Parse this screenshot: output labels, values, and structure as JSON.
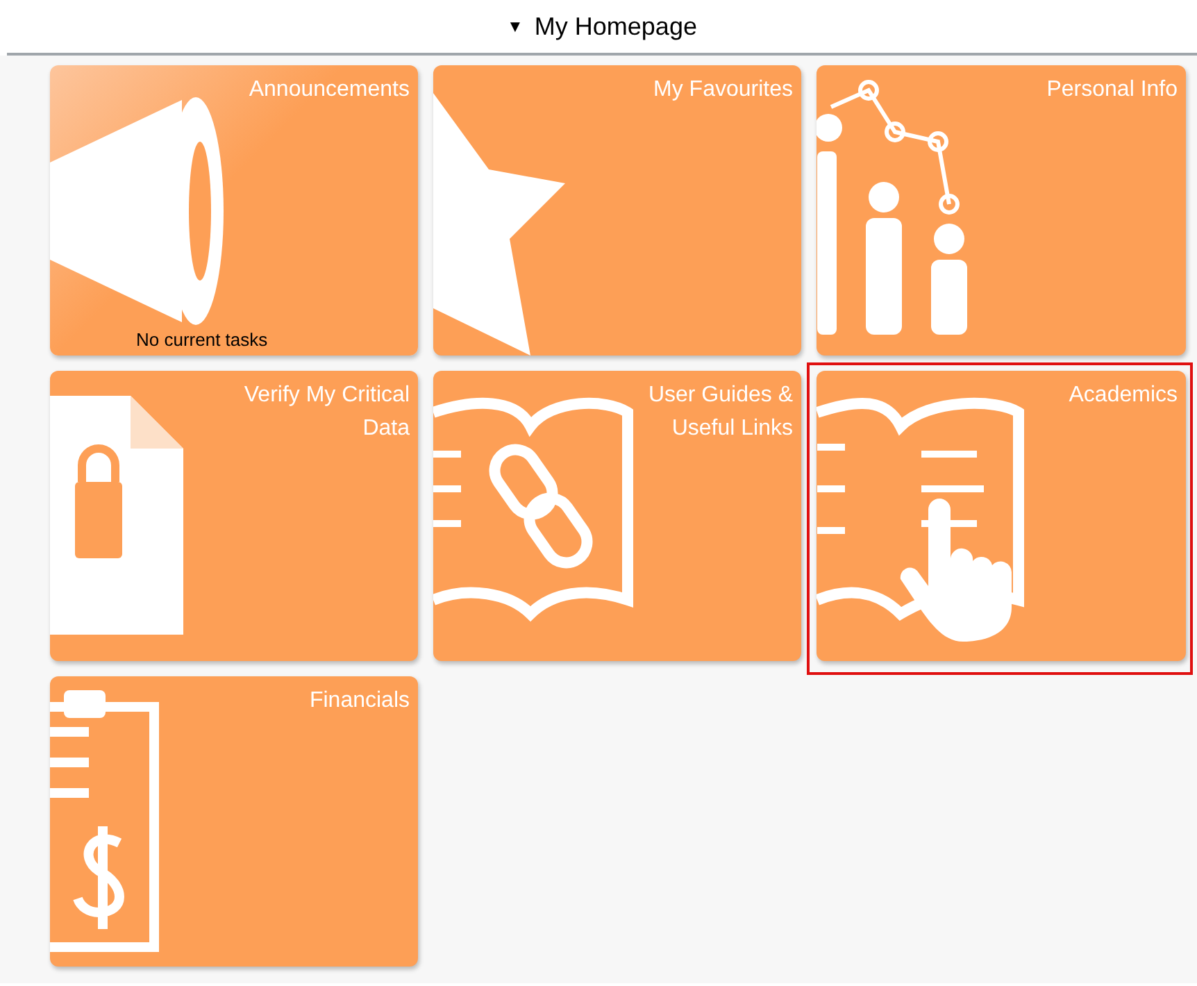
{
  "header": {
    "caret": "▼",
    "title": "My Homepage"
  },
  "tiles": [
    {
      "title": "Announcements",
      "note": "No current tasks",
      "highlighted": false
    },
    {
      "title": "My Favourites",
      "highlighted": false
    },
    {
      "title": "Personal Info",
      "highlighted": false
    },
    {
      "title": "Verify My Critical Data",
      "highlighted": false
    },
    {
      "title": "User Guides & Useful Links",
      "highlighted": false
    },
    {
      "title": "Academics",
      "highlighted": true
    },
    {
      "title": "Financials",
      "highlighted": false
    }
  ]
}
